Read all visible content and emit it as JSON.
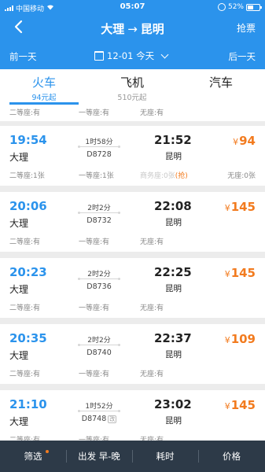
{
  "status_bar": {
    "carrier": "中国移动",
    "time": "05:07",
    "battery": "52%"
  },
  "header": {
    "from": "大理",
    "arrow": "→",
    "to": "昆明",
    "grab_label": "抢票",
    "prev_day": "前一天",
    "next_day": "后一天",
    "date": "12-01 今天"
  },
  "tabs": [
    {
      "name": "火车",
      "price": "94元起",
      "active": true
    },
    {
      "name": "飞机",
      "price": "510元起",
      "active": false
    },
    {
      "name": "汽车",
      "price": "",
      "active": false
    }
  ],
  "partial_row": {
    "seat1": "二等座:有",
    "seat2": "一等座:有",
    "seat3": "无座:有"
  },
  "trains": [
    {
      "depart": "19:54",
      "from": "大理",
      "duration": "1时58分",
      "train_no": "D8728",
      "arrive": "21:52",
      "to": "昆明",
      "price_symbol": "¥",
      "price": "94",
      "seat1": "二等座:1张",
      "seat2": "一等座:1张",
      "seat3": "商务座:0张",
      "seat3_tag": "(抢)",
      "seat4": "无座:0张"
    },
    {
      "depart": "20:06",
      "from": "大理",
      "duration": "2时2分",
      "train_no": "D8732",
      "arrive": "22:08",
      "to": "昆明",
      "price_symbol": "¥",
      "price": "145",
      "seat1": "二等座:有",
      "seat2": "一等座:有",
      "seat3": "无座:有",
      "seat3_tag": "",
      "seat4": ""
    },
    {
      "depart": "20:23",
      "from": "大理",
      "duration": "2时2分",
      "train_no": "D8736",
      "arrive": "22:25",
      "to": "昆明",
      "price_symbol": "¥",
      "price": "145",
      "seat1": "二等座:有",
      "seat2": "一等座:有",
      "seat3": "无座:有",
      "seat3_tag": "",
      "seat4": ""
    },
    {
      "depart": "20:35",
      "from": "大理",
      "duration": "2时2分",
      "train_no": "D8740",
      "arrive": "22:37",
      "to": "昆明",
      "price_symbol": "¥",
      "price": "109",
      "seat1": "二等座:有",
      "seat2": "一等座:有",
      "seat3": "无座:有",
      "seat3_tag": "",
      "seat4": ""
    },
    {
      "depart": "21:10",
      "from": "大理",
      "duration": "1时52分",
      "train_no": "D8748",
      "train_tag": "改",
      "arrive": "23:02",
      "to": "昆明",
      "price_symbol": "¥",
      "price": "145",
      "seat1": "二等座:有",
      "seat2": "一等座:有",
      "seat3": "无座:有",
      "seat3_tag": "",
      "seat4": ""
    }
  ],
  "bottom_bar": {
    "filter": "筛选",
    "depart_sort": "出发 早-晚",
    "duration": "耗时",
    "price": "价格"
  }
}
